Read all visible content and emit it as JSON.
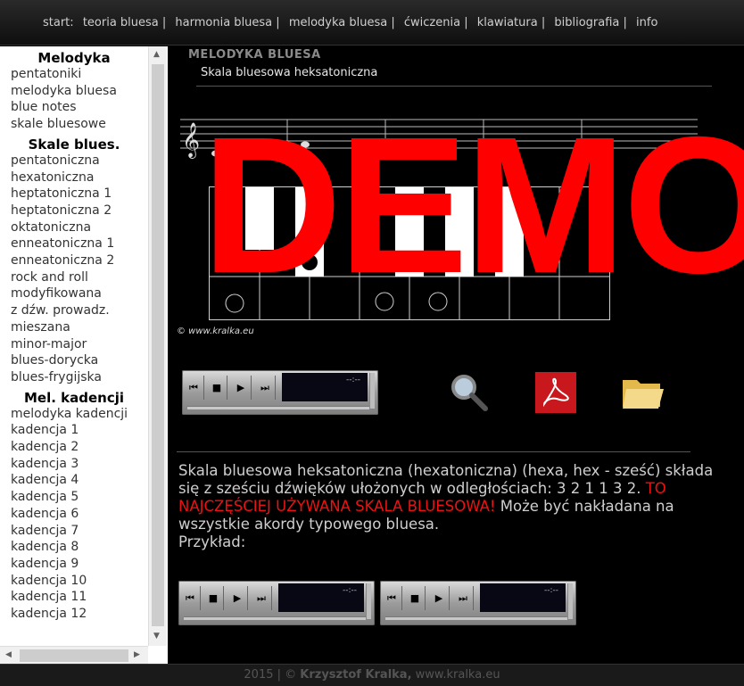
{
  "nav": {
    "prefix": "start:",
    "items": [
      "teoria bluesa |",
      "harmonia bluesa |",
      "melodyka bluesa |",
      "ćwiczenia |",
      "klawiatura |",
      "bibliografia |",
      "info"
    ]
  },
  "sidebar": {
    "sections": [
      {
        "title": "Melodyka",
        "items": [
          "pentatoniki",
          "melodyka bluesa",
          "blue notes",
          "skale bluesowe"
        ]
      },
      {
        "title": "Skale blues.",
        "items": [
          "pentatoniczna",
          "hexatoniczna",
          "heptatoniczna 1",
          "heptatoniczna 2",
          "oktatoniczna",
          "enneatoniczna 1",
          "enneatoniczna 2",
          "rock and roll",
          "modyfikowana",
          "z dźw. prowadz.",
          "mieszana",
          "minor-major",
          "blues-dorycka",
          "blues-frygijska"
        ]
      },
      {
        "title": "Mel. kadencji",
        "items": [
          "melodyka kadencji",
          "kadencja 1",
          "kadencja 2",
          "kadencja 3",
          "kadencja 4",
          "kadencja 5",
          "kadencja 6",
          "kadencja 7",
          "kadencja 8",
          "kadencja 9",
          "kadencja 10",
          "kadencja 11",
          "kadencja 12"
        ]
      }
    ]
  },
  "main": {
    "section_title": "MELODYKA BLUESA",
    "subtitle": "Skala bluesowa heksatoniczna",
    "copyright": "© www.kralka.eu",
    "player_time": "--:--",
    "description_part1": "Skala bluesowa heksatoniczna (hexatoniczna) (hexa, hex - sześć) składa się z sześciu dźwięków ułożonych w odległościach: 3 2 1 1 3 2. ",
    "description_red": "TO NAJCZĘŚCIEJ UŻYWANA SKALA BLUESOWA!",
    "description_part2": " Może być nakładana na wszystkie akordy typowego bluesa.",
    "description_example": "Przykład:"
  },
  "watermark": "DEMO",
  "footer": {
    "year": "2015 | © ",
    "author": "Krzysztof Kralka,",
    "site": " www.kralka.eu"
  },
  "icons": [
    "zoom-icon",
    "pdf-icon",
    "folder-icon"
  ],
  "colors": {
    "accent_red": "#ff0000"
  }
}
